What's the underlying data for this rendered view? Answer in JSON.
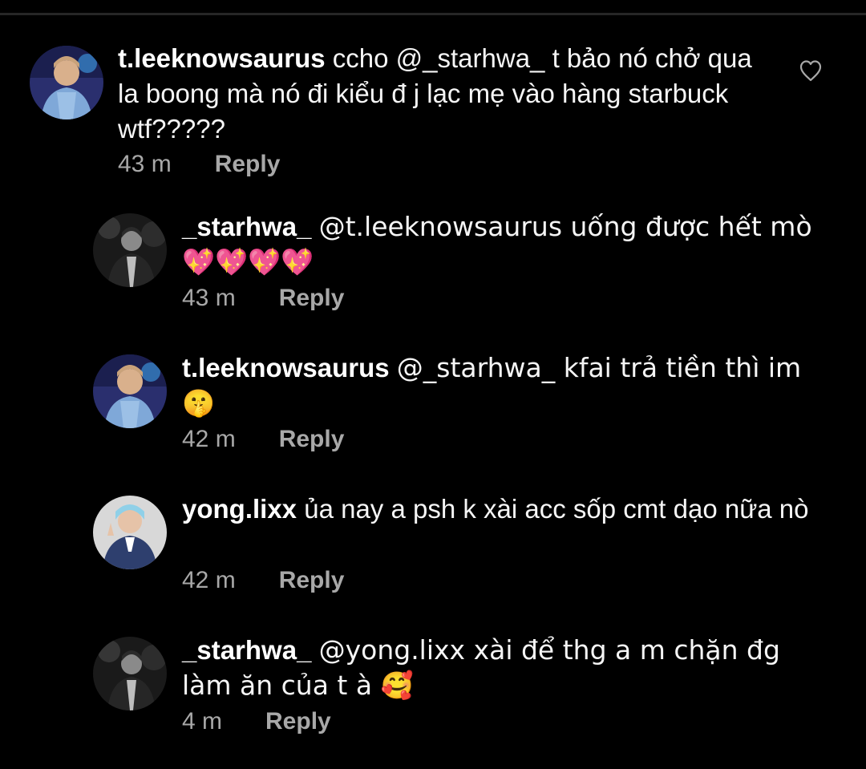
{
  "colors": {
    "background": "#000000",
    "text": "#f5f5f5",
    "secondary_text": "#a8a8a8",
    "divider": "#262626"
  },
  "comments": [
    {
      "username": "t.leeknowsaurus",
      "text": "ccho @_starhwa_ t bảo nó chở qua la boong mà nó đi kiểu đ j lạc mẹ vào hàng starbuck wtf?????",
      "time": "43 m",
      "reply_label": "Reply",
      "like_icon": "heart-outline-icon"
    },
    {
      "username": "_starhwa_",
      "text": "@t.leeknowsaurus uống được hết mò 💖💖💖💖",
      "time": "43 m",
      "reply_label": "Reply"
    },
    {
      "username": "t.leeknowsaurus",
      "text": "@_starhwa_ kfai trả tiền thì im 🤫",
      "time": "42 m",
      "reply_label": "Reply"
    },
    {
      "username": "yong.lixx",
      "text": "ủa nay a psh k xài acc sốp cmt dạo nữa nò",
      "time": "42 m",
      "reply_label": "Reply"
    },
    {
      "username": "_starhwa_",
      "text": "@yong.lixx xài để thg a m chặn đg làm ăn của t à 🥰",
      "time": "4 m",
      "reply_label": "Reply"
    }
  ]
}
